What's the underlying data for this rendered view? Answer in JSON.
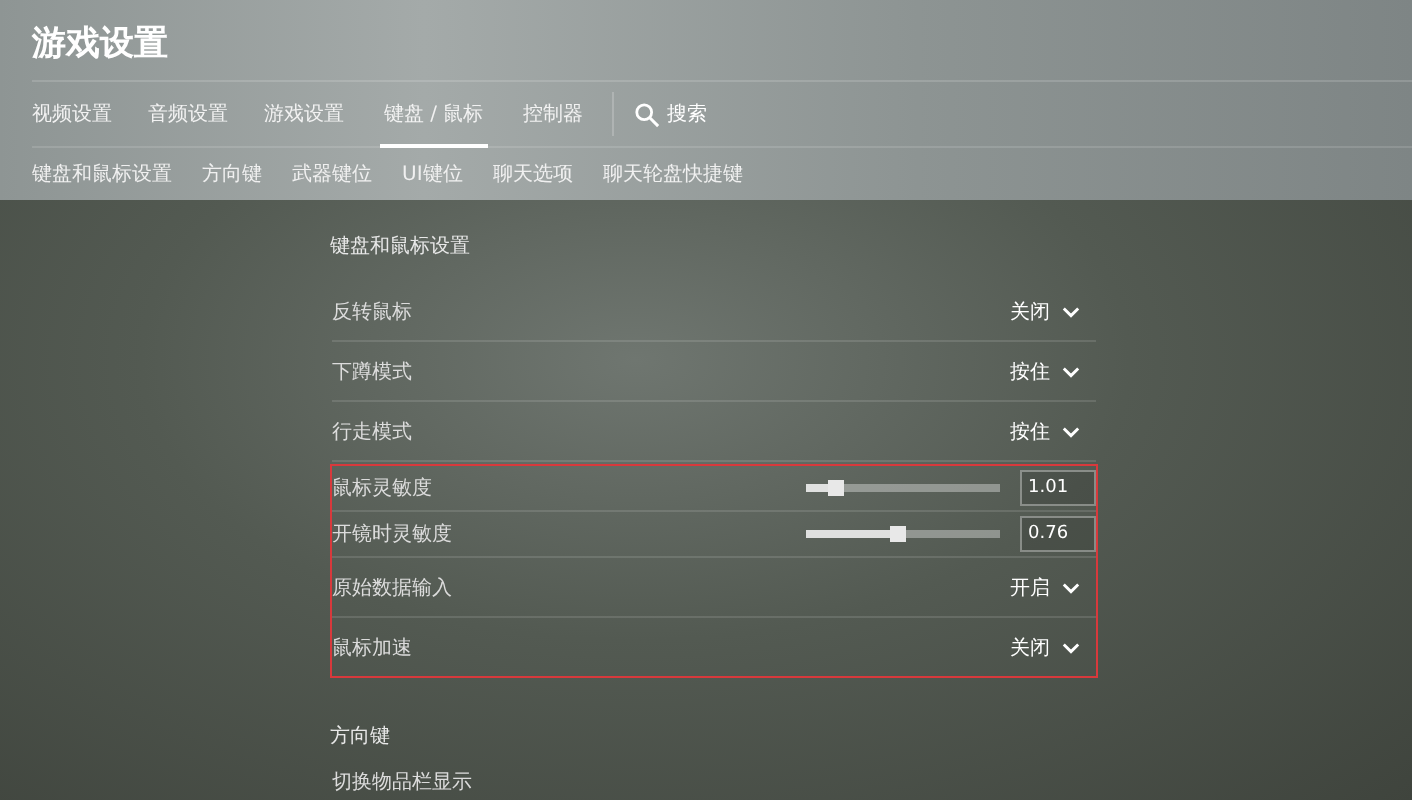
{
  "window": {
    "title": "游戏设置"
  },
  "tabs": [
    {
      "label": "视频设置",
      "selected": false
    },
    {
      "label": "音频设置",
      "selected": false
    },
    {
      "label": "游戏设置",
      "selected": false
    },
    {
      "label": "键盘 / 鼠标",
      "selected": true
    },
    {
      "label": "控制器",
      "selected": false
    }
  ],
  "search": {
    "label": "搜索"
  },
  "subtabs": [
    "键盘和鼠标设置",
    "方向键",
    "武器键位",
    "UI键位",
    "聊天选项",
    "聊天轮盘快捷键"
  ],
  "sections": [
    {
      "title": "键盘和鼠标设置",
      "groups": [
        {
          "highlighted": false,
          "rows": [
            {
              "kind": "dropdown",
              "label": "反转鼠标",
              "value": "关闭"
            },
            {
              "kind": "dropdown",
              "label": "下蹲模式",
              "value": "按住"
            },
            {
              "kind": "dropdown",
              "label": "行走模式",
              "value": "按住"
            }
          ]
        },
        {
          "highlighted": true,
          "rows": [
            {
              "kind": "slider",
              "label": "鼠标灵敏度",
              "level": 0.15,
              "value": "1.01"
            },
            {
              "kind": "slider",
              "label": "开镜时灵敏度",
              "level": 0.47,
              "value": "0.76"
            },
            {
              "kind": "dropdown",
              "label": "原始数据输入",
              "value": "开启"
            },
            {
              "kind": "dropdown",
              "label": "鼠标加速",
              "value": "关闭"
            }
          ]
        }
      ]
    },
    {
      "title": "方向键",
      "groups": [
        {
          "highlighted": false,
          "rows": [
            {
              "kind": "plain",
              "label": "切换物品栏显示"
            }
          ]
        }
      ]
    }
  ]
}
